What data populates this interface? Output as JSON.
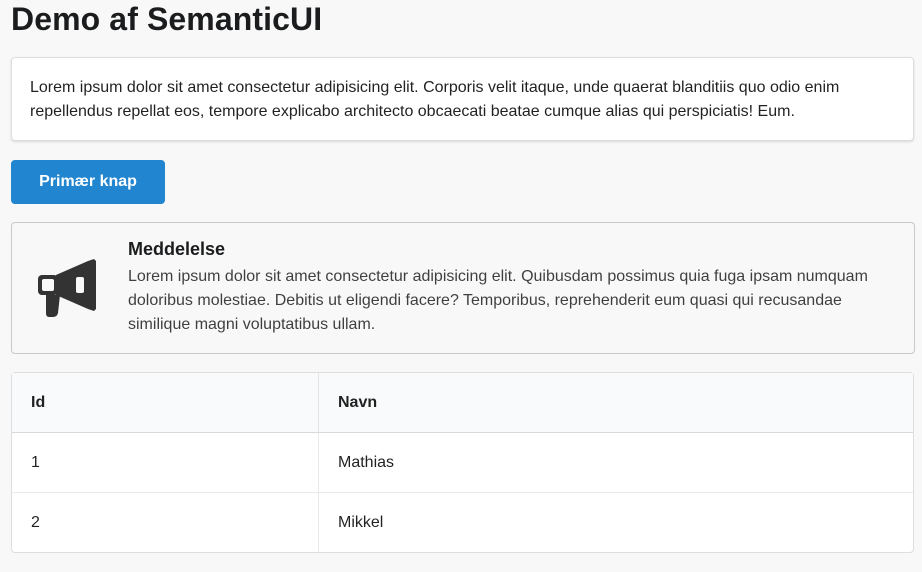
{
  "page": {
    "title": "Demo af SemanticUI"
  },
  "segment": {
    "text": "Lorem ipsum dolor sit amet consectetur adipisicing elit. Corporis velit itaque, unde quaerat blanditiis quo odio enim repellendus repellat eos, tempore explicabo architecto obcaecati beatae cumque alias qui perspiciatis! Eum."
  },
  "primary_button": {
    "label": "Primær knap",
    "color": "#2185d0"
  },
  "message": {
    "icon": "bullhorn-icon",
    "header": "Meddelelse",
    "content": "Lorem ipsum dolor sit amet consectetur adipisicing elit. Quibusdam possimus quia fuga ipsam numquam doloribus molestiae. Debitis ut eligendi facere? Temporibus, reprehenderit eum quasi qui recusandae similique magni voluptatibus ullam."
  },
  "table": {
    "headers": [
      "Id",
      "Navn"
    ],
    "rows": [
      [
        "1",
        "Mathias"
      ],
      [
        "2",
        "Mikkel"
      ]
    ]
  }
}
